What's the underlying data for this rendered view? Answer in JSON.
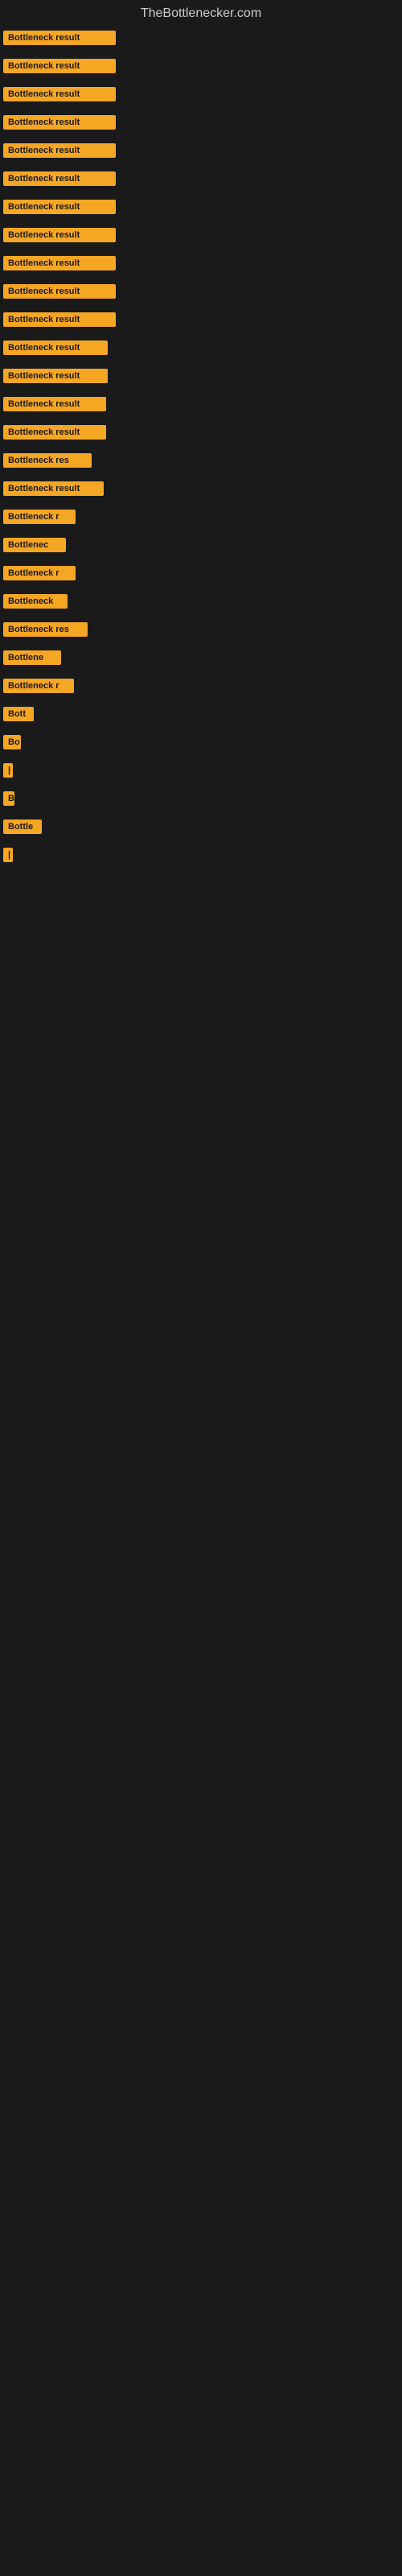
{
  "site": {
    "title": "TheBottlenecker.com"
  },
  "bars": [
    {
      "label": "Bottleneck result",
      "width": 140
    },
    {
      "label": "Bottleneck result",
      "width": 140
    },
    {
      "label": "Bottleneck result",
      "width": 140
    },
    {
      "label": "Bottleneck result",
      "width": 140
    },
    {
      "label": "Bottleneck result",
      "width": 140
    },
    {
      "label": "Bottleneck result",
      "width": 140
    },
    {
      "label": "Bottleneck result",
      "width": 140
    },
    {
      "label": "Bottleneck result",
      "width": 140
    },
    {
      "label": "Bottleneck result",
      "width": 140
    },
    {
      "label": "Bottleneck result",
      "width": 140
    },
    {
      "label": "Bottleneck result",
      "width": 140
    },
    {
      "label": "Bottleneck result",
      "width": 130
    },
    {
      "label": "Bottleneck result",
      "width": 130
    },
    {
      "label": "Bottleneck result",
      "width": 128
    },
    {
      "label": "Bottleneck result",
      "width": 128
    },
    {
      "label": "Bottleneck res",
      "width": 110
    },
    {
      "label": "Bottleneck result",
      "width": 125
    },
    {
      "label": "Bottleneck r",
      "width": 90
    },
    {
      "label": "Bottlenec",
      "width": 78
    },
    {
      "label": "Bottleneck r",
      "width": 90
    },
    {
      "label": "Bottleneck",
      "width": 80
    },
    {
      "label": "Bottleneck res",
      "width": 105
    },
    {
      "label": "Bottlene",
      "width": 72
    },
    {
      "label": "Bottleneck r",
      "width": 88
    },
    {
      "label": "Bott",
      "width": 38
    },
    {
      "label": "Bo",
      "width": 22
    },
    {
      "label": "|",
      "width": 8
    },
    {
      "label": "B",
      "width": 14
    },
    {
      "label": "Bottle",
      "width": 48
    },
    {
      "label": "|",
      "width": 8
    }
  ]
}
